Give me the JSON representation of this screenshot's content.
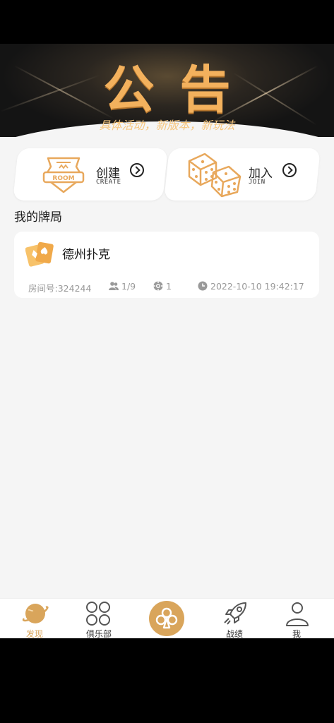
{
  "banner": {
    "title": "公告",
    "subtitle": "具体活动，新版本，新玩法"
  },
  "actions": {
    "create": {
      "title": "创建",
      "subtitle": "CREATE",
      "badge": "ROOM"
    },
    "join": {
      "title": "加入",
      "subtitle": "JOIN"
    }
  },
  "section": {
    "title": "我的牌局"
  },
  "game": {
    "name": "德州扑克",
    "room": "房间号:324244",
    "players": "1/9",
    "chips": "1",
    "time": "2022-10-10 19:42:17"
  },
  "tabs": [
    {
      "label": "发现",
      "icon": "planet-icon",
      "active": true
    },
    {
      "label": "俱乐部",
      "icon": "grid-circles-icon"
    },
    {
      "label": "",
      "icon": "club-icon"
    },
    {
      "label": "战绩",
      "icon": "rocket-icon"
    },
    {
      "label": "我",
      "icon": "user-icon"
    }
  ],
  "colors": {
    "accent": "#d9a55b",
    "banner_gold": "#f3b15d"
  }
}
